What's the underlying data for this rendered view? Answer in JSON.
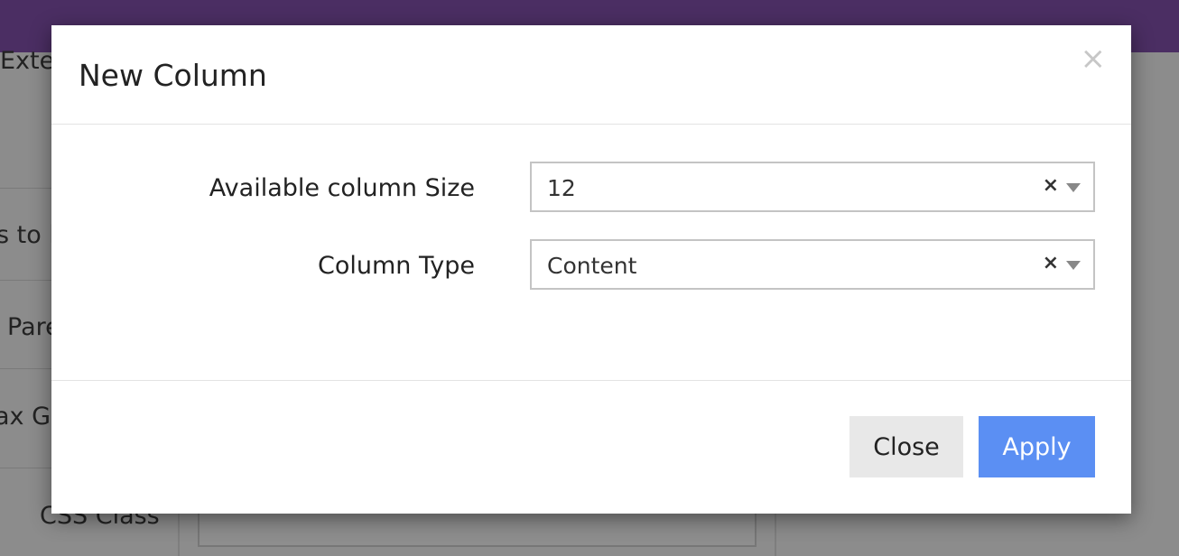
{
  "background": {
    "labels": [
      "Exte",
      "s to l",
      "Pare",
      "ax Gri",
      "CSS Class"
    ]
  },
  "modal": {
    "title": "New Column",
    "close_icon": "×",
    "fields": [
      {
        "label": "Available column Size",
        "value": "12",
        "clear": "×"
      },
      {
        "label": "Column Type",
        "value": "Content",
        "clear": "×"
      }
    ],
    "buttons": {
      "close": "Close",
      "apply": "Apply"
    },
    "colors": {
      "apply": "#5b8ff3",
      "close": "#e8e8e8",
      "topbar": "#4b2e63"
    }
  }
}
